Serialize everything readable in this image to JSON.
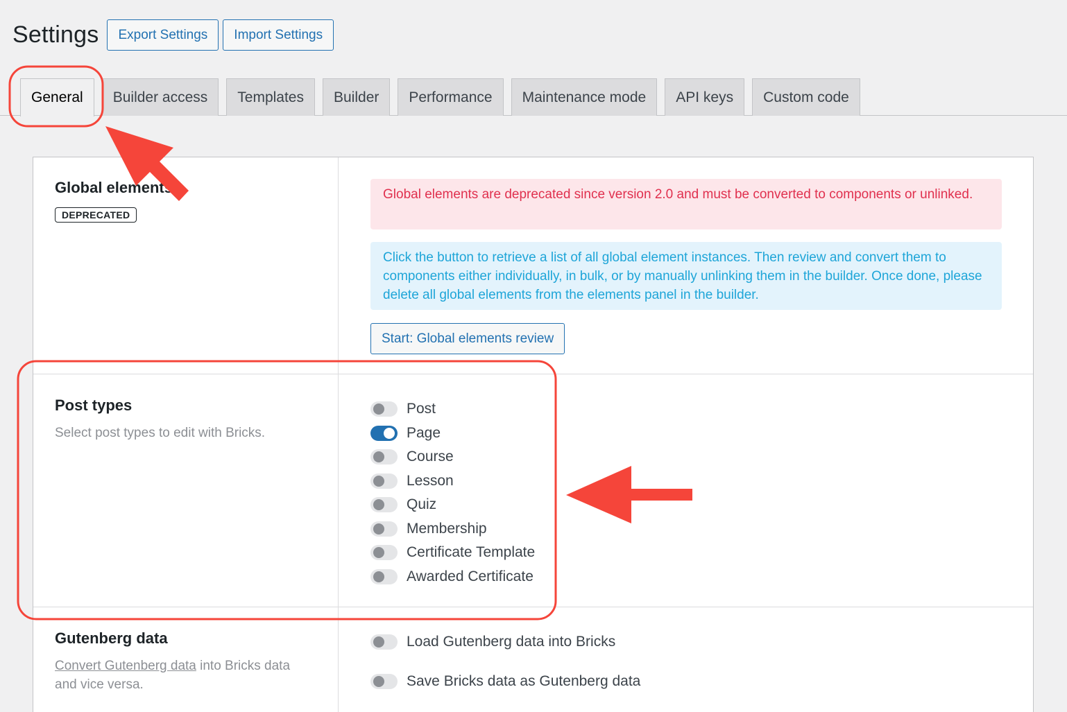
{
  "header": {
    "title": "Settings",
    "export_label": "Export Settings",
    "import_label": "Import Settings"
  },
  "tabs": [
    {
      "label": "General",
      "active": true
    },
    {
      "label": "Builder access"
    },
    {
      "label": "Templates"
    },
    {
      "label": "Builder"
    },
    {
      "label": "Performance"
    },
    {
      "label": "Maintenance mode"
    },
    {
      "label": "API keys"
    },
    {
      "label": "Custom code"
    }
  ],
  "global_elements": {
    "title": "Global elements",
    "badge": "DEPRECATED",
    "notice_deprecated": "Global elements are deprecated since version 2.0 and must be converted to components or unlinked.",
    "notice_info": "Click the button to retrieve a list of all global element instances. Then review and convert them to components either individually, in bulk, or by manually unlinking them in the builder. Once done, please delete all global elements from the elements panel in the builder.",
    "review_button": "Start: Global elements review"
  },
  "post_types": {
    "title": "Post types",
    "description": "Select post types to edit with Bricks.",
    "items": [
      {
        "label": "Post",
        "enabled": false
      },
      {
        "label": "Page",
        "enabled": true
      },
      {
        "label": "Course",
        "enabled": false
      },
      {
        "label": "Lesson",
        "enabled": false
      },
      {
        "label": "Quiz",
        "enabled": false
      },
      {
        "label": "Membership",
        "enabled": false
      },
      {
        "label": "Certificate Template",
        "enabled": false
      },
      {
        "label": "Awarded Certificate",
        "enabled": false
      }
    ]
  },
  "gutenberg": {
    "title": "Gutenberg data",
    "desc_link": "Convert Gutenberg data",
    "desc_rest": " into Bricks data",
    "desc_line2": "and vice versa.",
    "options": [
      {
        "label": "Load Gutenberg data into Bricks",
        "enabled": false
      },
      {
        "label": "Save Bricks data as Gutenberg data",
        "enabled": false
      }
    ]
  },
  "colors": {
    "accent": "#2271b1",
    "annotation": "#f5453a",
    "error_text": "#e0304e",
    "info_text": "#1ea5d8"
  }
}
